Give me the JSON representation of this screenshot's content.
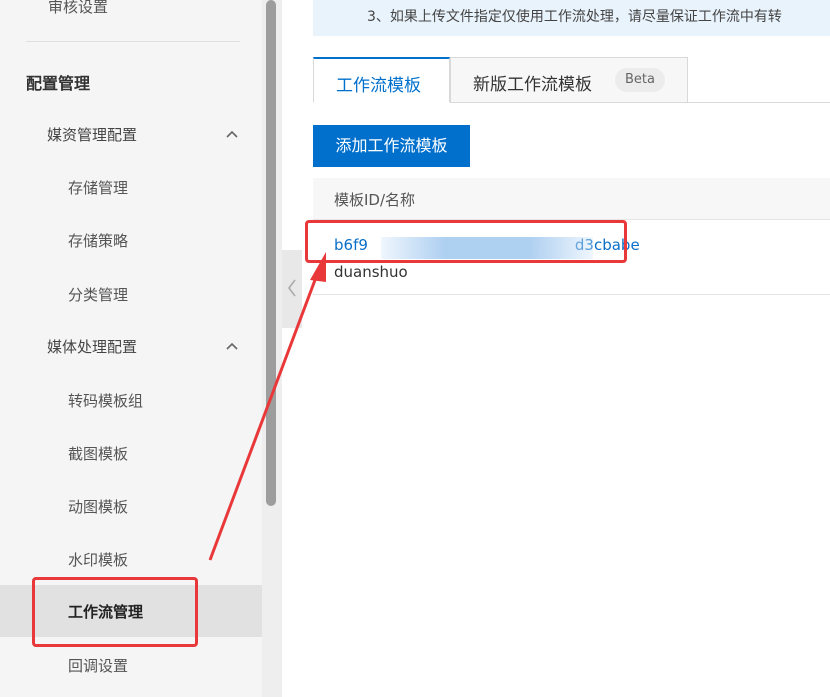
{
  "sidebar": {
    "top_item": "审核设置",
    "group_title": "配置管理",
    "media_asset_config": {
      "label": "媒资管理配置",
      "items": [
        "存储管理",
        "存储策略",
        "分类管理"
      ]
    },
    "media_process_config": {
      "label": "媒体处理配置",
      "items": [
        "转码模板组",
        "截图模板",
        "动图模板",
        "水印模板",
        "工作流管理",
        "回调设置"
      ]
    },
    "active_item": "工作流管理"
  },
  "notice": {
    "text": "3、如果上传文件指定仅使用工作流处理，请尽量保证工作流中有转"
  },
  "tabs": [
    {
      "label": "工作流模板"
    },
    {
      "label": "新版工作流模板",
      "badge": "Beta"
    }
  ],
  "add_button_label": "添加工作流模板",
  "table": {
    "header": "模板ID/名称",
    "rows": [
      {
        "id_prefix": "b6f9",
        "id_suffix": "d3cbabe",
        "name": "duanshuo"
      }
    ]
  },
  "colors": {
    "accent": "#0070cc",
    "annotation": "#e8383a",
    "link": "#0a6fc8"
  }
}
